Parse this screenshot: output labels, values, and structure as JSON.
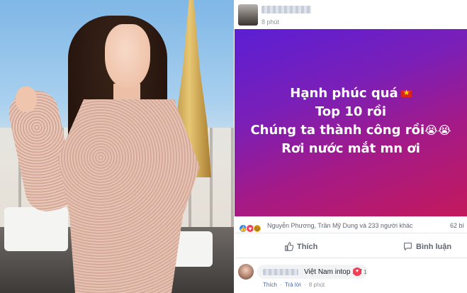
{
  "post": {
    "time": "8 phút",
    "banner_lines": [
      "Hạnh phúc quá",
      "Top 10 rồi",
      "Chúng ta thành công rồi",
      "Rơi nước mắt mn ơi"
    ],
    "reactions": {
      "summary": "Nguyễn Phương, Trần Mỹ Dung và 233 người khác",
      "comments_count": "62 bì"
    },
    "actions": {
      "like_label": "Thích",
      "comment_label": "Bình luận"
    },
    "comment": {
      "text": "Việt Nam intop 10!",
      "reaction_count": "1",
      "like_link": "Thích",
      "reply_link": "Trả lời",
      "time": "8 phút"
    }
  },
  "colors": {
    "banner_start": "#5b1fd4",
    "banner_end": "#c3195c",
    "link": "#4267b2"
  }
}
